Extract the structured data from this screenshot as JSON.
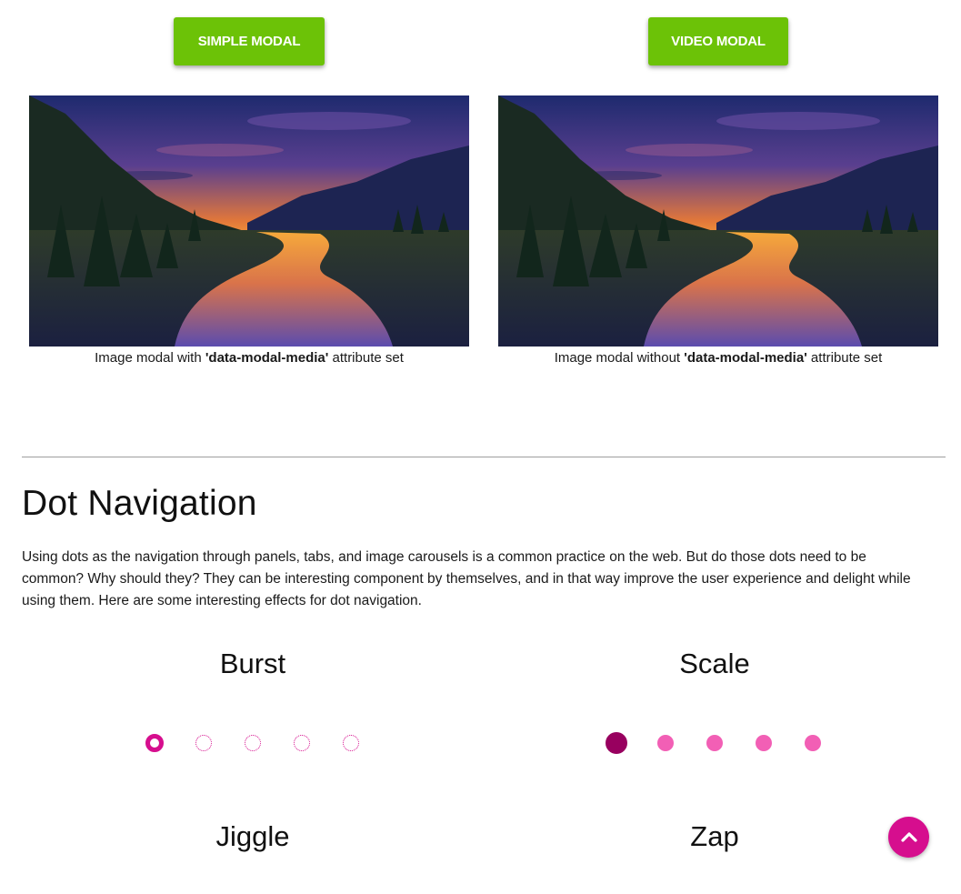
{
  "buttons": {
    "simple_modal": "SIMPLE MODAL",
    "video_modal": "VIDEO MODAL"
  },
  "figures": [
    {
      "caption_before": "Image modal with ",
      "caption_bold": "'data-modal-media'",
      "caption_after": " attribute set"
    },
    {
      "caption_before": "Image modal without ",
      "caption_bold": "'data-modal-media'",
      "caption_after": " attribute set"
    }
  ],
  "dot_navigation": {
    "title": "Dot Navigation",
    "description": "Using dots as the navigation through panels, tabs, and image carousels is a common practice on the web. But do those dots need to be common? Why should they? They can be interesting component by themselves, and in that way improve the user experience and delight while using them. Here are some interesting effects for dot navigation.",
    "demos": [
      {
        "title": "Burst",
        "style": "burst",
        "dot_count": 5,
        "active_index": 0
      },
      {
        "title": "Scale",
        "style": "scale",
        "dot_count": 5,
        "active_index": 0
      },
      {
        "title": "Jiggle"
      },
      {
        "title": "Zap"
      }
    ]
  },
  "colors": {
    "button_green": "#6cc207",
    "accent_pink": "#d60e8e",
    "scale_active": "#98005f",
    "scale_idle": "#f25fb5"
  },
  "icons": {
    "back_to_top": "chevron-up-icon"
  }
}
